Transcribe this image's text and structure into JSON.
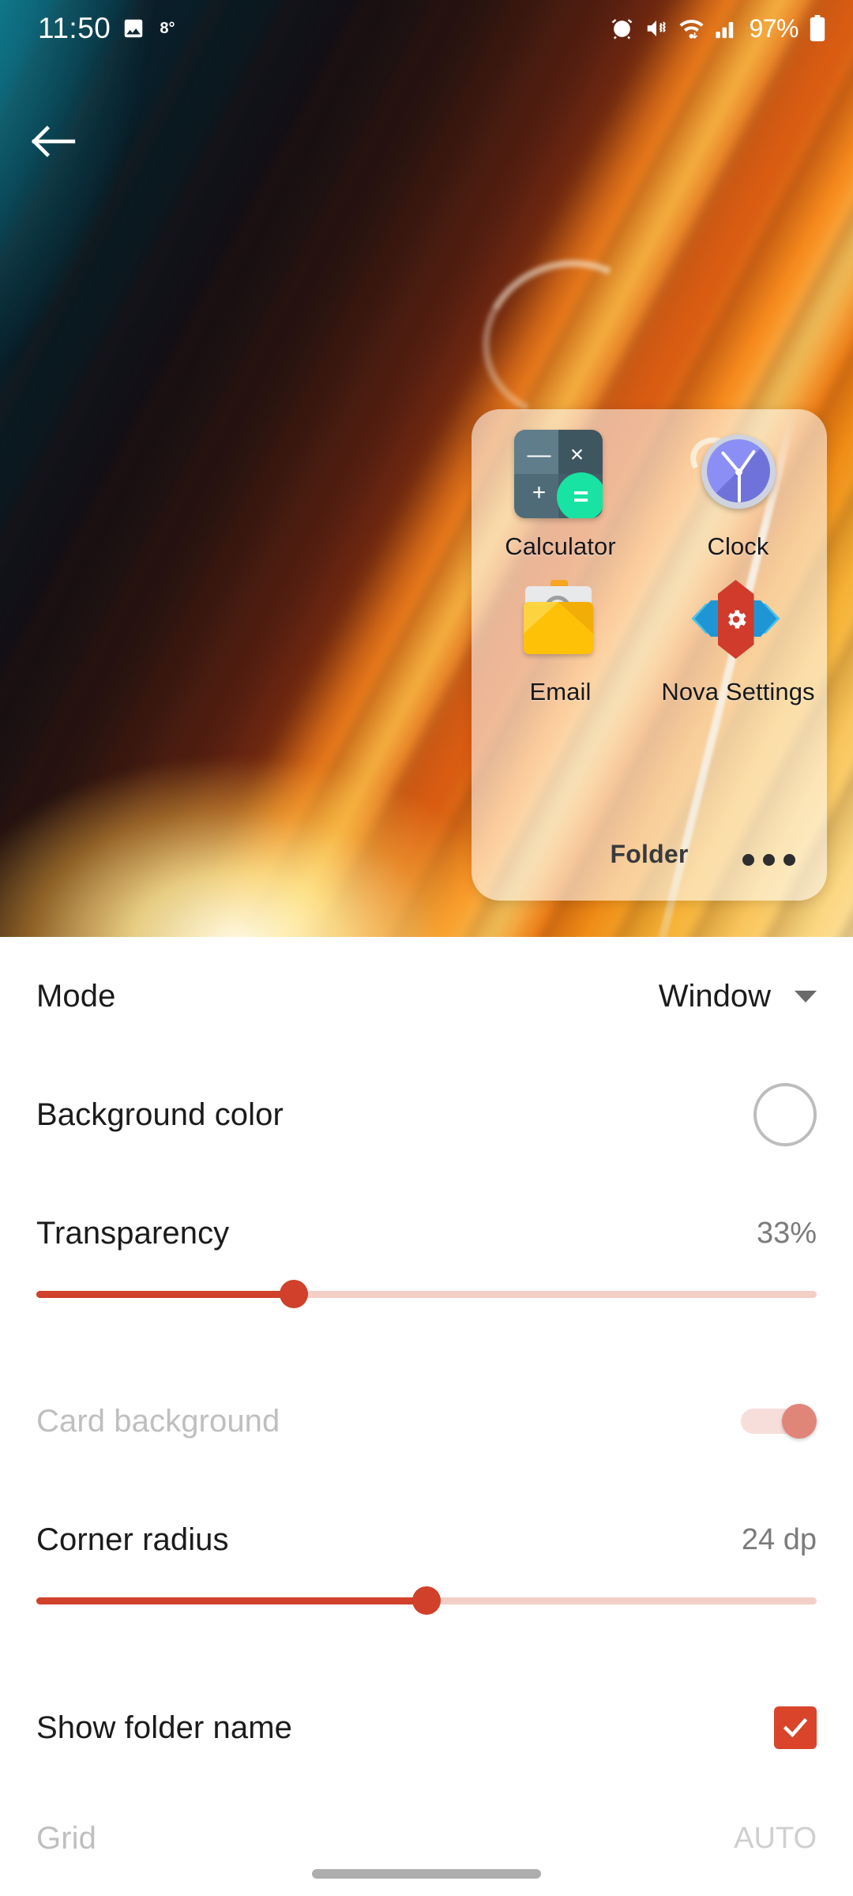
{
  "status_bar": {
    "time": "11:50",
    "temperature": "8°",
    "battery_percent": "97%",
    "icons": [
      "photo-icon",
      "alarm-icon",
      "vibrate-mute-icon",
      "wifi-icon",
      "cellular-signal-icon",
      "battery-icon"
    ]
  },
  "nav": {
    "back_label": "back-arrow"
  },
  "folder_preview": {
    "name": "Folder",
    "overflow_label": "•••",
    "apps": [
      {
        "label": "Calculator",
        "icon": "calculator-icon"
      },
      {
        "label": "Clock",
        "icon": "clock-icon"
      },
      {
        "label": "Email",
        "icon": "email-icon"
      },
      {
        "label": "Nova Settings",
        "icon": "nova-settings-icon"
      }
    ],
    "calculator_symbols": {
      "minus": "—",
      "times": "×",
      "plus": "+",
      "equals": "="
    },
    "email_symbol": "@"
  },
  "settings": {
    "mode": {
      "label": "Mode",
      "value": "Window",
      "control": "dropdown"
    },
    "background_color": {
      "label": "Background color",
      "control": "color-swatch",
      "value": "#FFFFFF"
    },
    "transparency": {
      "label": "Transparency",
      "value": "33%",
      "percent": 33,
      "control": "slider"
    },
    "card_background": {
      "label": "Card background",
      "control": "toggle",
      "enabled": false,
      "checked": true
    },
    "corner_radius": {
      "label": "Corner radius",
      "value": "24 dp",
      "percent": 50,
      "control": "slider"
    },
    "show_folder_name": {
      "label": "Show folder name",
      "control": "checkbox",
      "checked": true
    },
    "grid": {
      "label": "Grid",
      "value": "AUTO",
      "control": "dropdown"
    }
  },
  "theme": {
    "accent": "#D0402A",
    "slider_track": "#F4CFC6",
    "checkbox_fill": "#D9442B",
    "panel_background": "#FFFFFF",
    "label_color": "#1B1B1B",
    "value_color": "#7B7B7B",
    "disabled_color": "#BFBFBF"
  }
}
